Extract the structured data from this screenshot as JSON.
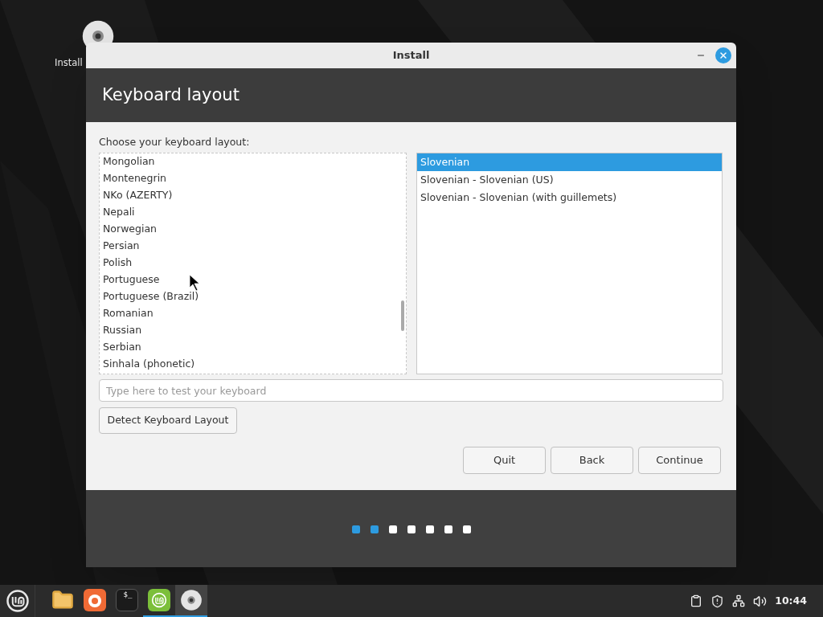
{
  "desktop": {
    "icons": [
      {
        "label": "Install"
      }
    ]
  },
  "window": {
    "title": "Install",
    "heading": "Keyboard layout",
    "prompt": "Choose your keyboard layout:",
    "layouts": [
      {
        "label": "Mongolian",
        "selected": false
      },
      {
        "label": "Montenegrin",
        "selected": false
      },
      {
        "label": "NKo (AZERTY)",
        "selected": false
      },
      {
        "label": "Nepali",
        "selected": false
      },
      {
        "label": "Norwegian",
        "selected": false
      },
      {
        "label": "Persian",
        "selected": false
      },
      {
        "label": "Polish",
        "selected": false
      },
      {
        "label": "Portuguese",
        "selected": false
      },
      {
        "label": "Portuguese (Brazil)",
        "selected": false
      },
      {
        "label": "Romanian",
        "selected": false
      },
      {
        "label": "Russian",
        "selected": false
      },
      {
        "label": "Serbian",
        "selected": false
      },
      {
        "label": "Sinhala (phonetic)",
        "selected": false
      }
    ],
    "variants": [
      {
        "label": "Slovenian",
        "selected": true
      },
      {
        "label": "Slovenian - Slovenian (US)",
        "selected": false
      },
      {
        "label": "Slovenian - Slovenian (with guillemets)",
        "selected": false
      }
    ],
    "test_field": {
      "placeholder": "Type here to test your keyboard"
    },
    "detect_button": "Detect Keyboard Layout",
    "buttons": [
      "Quit",
      "Back",
      "Continue"
    ],
    "steps": [
      {
        "done": true
      },
      {
        "done": true
      },
      {
        "done": false
      },
      {
        "done": false
      },
      {
        "done": false
      },
      {
        "done": false
      },
      {
        "done": false
      }
    ]
  },
  "taskbar": {
    "apps": [
      {
        "kind": "files",
        "running": false,
        "selected": false
      },
      {
        "kind": "browser",
        "running": false,
        "selected": false
      },
      {
        "kind": "terminal",
        "label": "$_",
        "running": false,
        "selected": false
      },
      {
        "kind": "mint",
        "running": true,
        "selected": false
      },
      {
        "kind": "disc",
        "running": true,
        "selected": true
      }
    ],
    "clock": "10:44"
  }
}
